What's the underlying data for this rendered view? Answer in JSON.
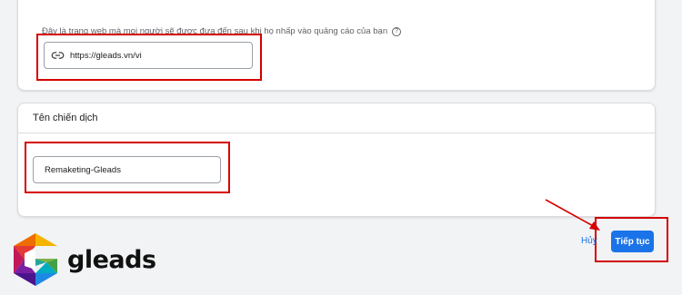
{
  "url_section": {
    "label": "Đây là trang web mà mọi người sẽ được đưa đến sau khi họ nhấp vào quảng cáo của bạn",
    "help_icon": "help-circle-icon",
    "url_value": "https://gleads.vn/vi",
    "link_icon": "link-icon"
  },
  "campaign_section": {
    "title": "Tên chiến dịch",
    "name_value": "Remaketing-Gleads"
  },
  "actions": {
    "cancel_label": "Hủy",
    "continue_label": "Tiếp tục"
  },
  "logo": {
    "text": "gleads"
  },
  "colors": {
    "accent": "#1a73e8",
    "highlight": "#d50000",
    "background": "#f1f3f4"
  }
}
